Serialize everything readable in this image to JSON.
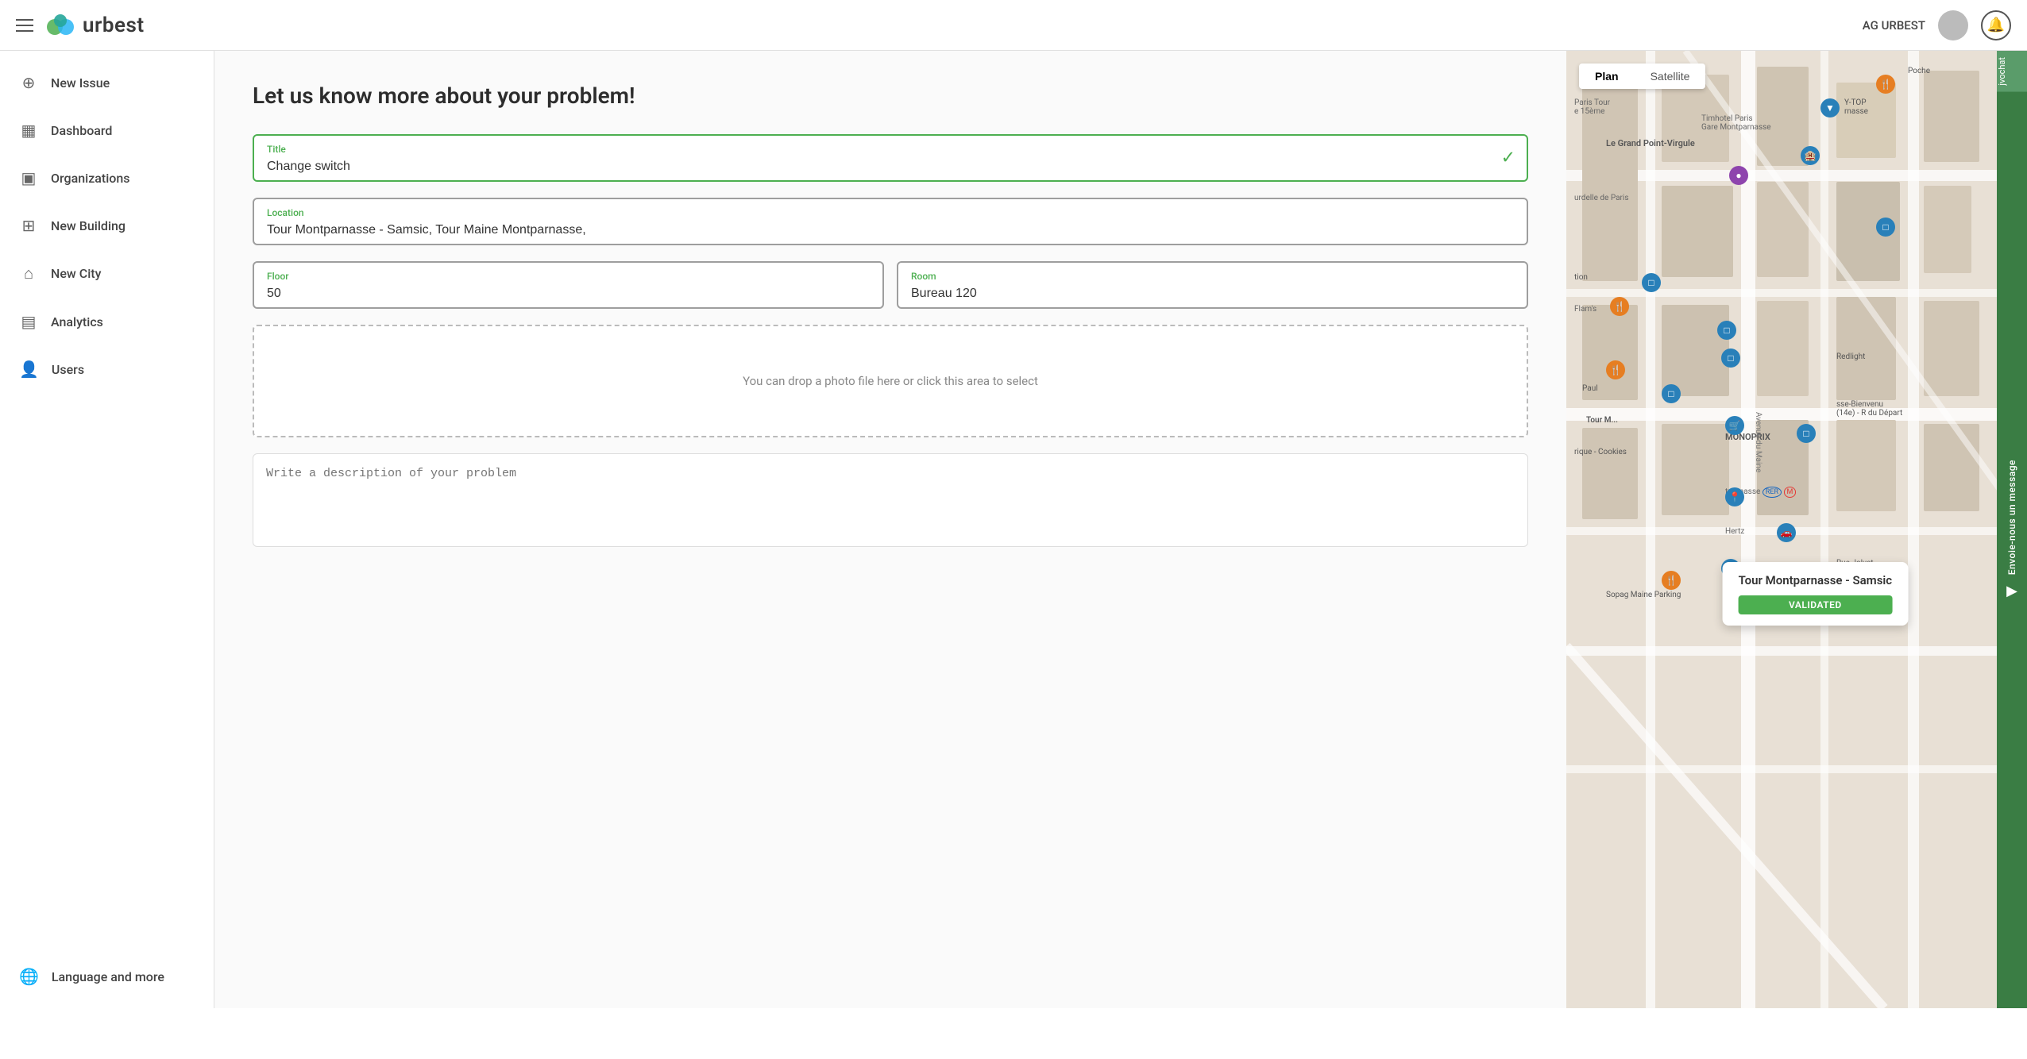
{
  "header": {
    "menu_label": "Menu",
    "logo_text": "urbest",
    "user_label": "AG URBEST",
    "bell_label": "Notifications"
  },
  "sidebar": {
    "items": [
      {
        "id": "new-issue",
        "label": "New Issue",
        "icon": "⊕"
      },
      {
        "id": "dashboard",
        "label": "Dashboard",
        "icon": "▦"
      },
      {
        "id": "organizations",
        "label": "Organizations",
        "icon": "▣"
      },
      {
        "id": "new-building",
        "label": "New Building",
        "icon": "⊞"
      },
      {
        "id": "new-city",
        "label": "New City",
        "icon": "⌂"
      },
      {
        "id": "analytics",
        "label": "Analytics",
        "icon": "▤"
      },
      {
        "id": "users",
        "label": "Users",
        "icon": "👤"
      }
    ],
    "bottom_items": [
      {
        "id": "language",
        "label": "Language and more",
        "icon": "🌐"
      }
    ]
  },
  "form": {
    "heading": "Let us know more about your problem!",
    "title_label": "Title",
    "title_value": "Change switch",
    "location_label": "Location",
    "location_value": "Tour Montparnasse - Samsic, Tour Maine Montparnasse,",
    "floor_label": "Floor",
    "floor_value": "50",
    "room_label": "Room",
    "room_value": "Bureau 120",
    "photo_placeholder": "You can drop a photo file here or click this area to select",
    "description_placeholder": "Write a description of your problem"
  },
  "map": {
    "plan_label": "Plan",
    "satellite_label": "Satellite",
    "tooltip_title": "Tour Montparnasse - Samsic",
    "validated_label": "VALIDATED",
    "chat_label": "Envoie-nous un message"
  }
}
